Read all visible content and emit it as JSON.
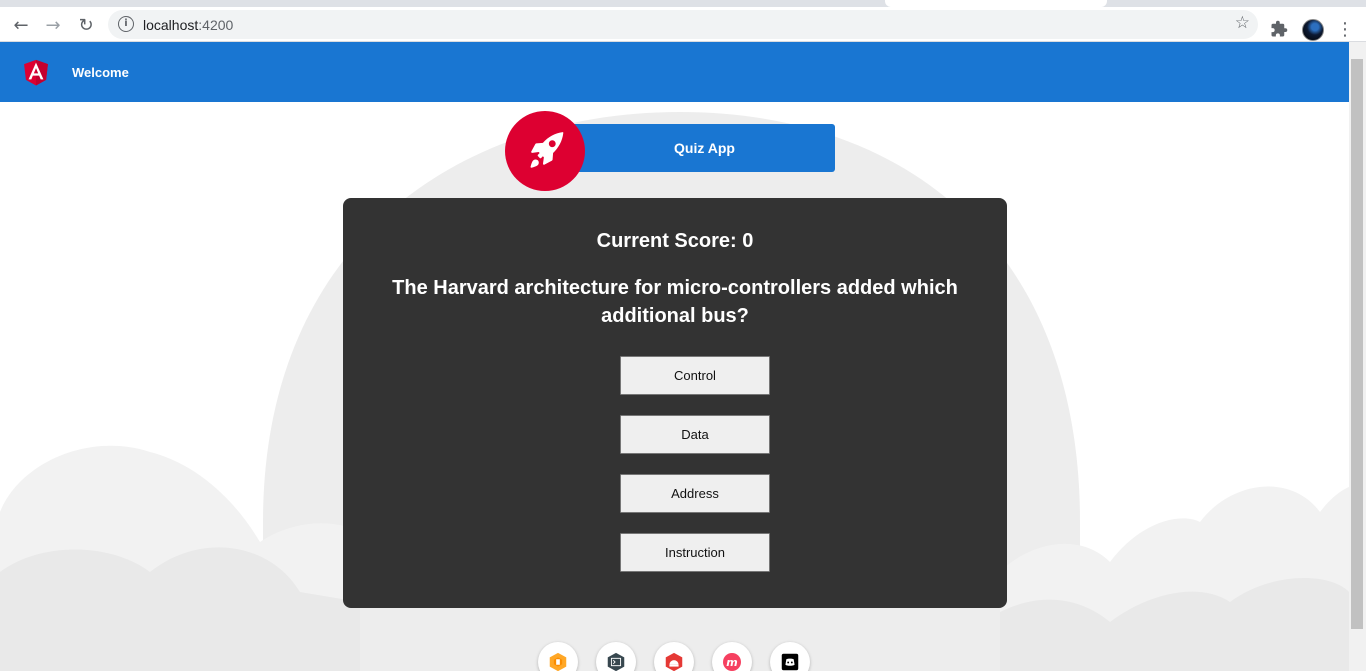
{
  "browser": {
    "url_host": "localhost",
    "url_port": ":4200"
  },
  "app": {
    "toolbar_title": "Welcome",
    "banner_title": "Quiz App"
  },
  "quiz": {
    "score_text": "Current Score: 0",
    "question": "The Harvard architecture for micro-controllers added which additional bus?",
    "options": [
      "Control",
      "Data",
      "Address",
      "Instruction"
    ]
  },
  "footer_links": [
    "animations-icon",
    "cli-icon",
    "material-icon",
    "meetup-icon",
    "discord-icon"
  ],
  "colors": {
    "primary": "#1976d2",
    "accent": "#dd0031",
    "card": "#333333"
  }
}
